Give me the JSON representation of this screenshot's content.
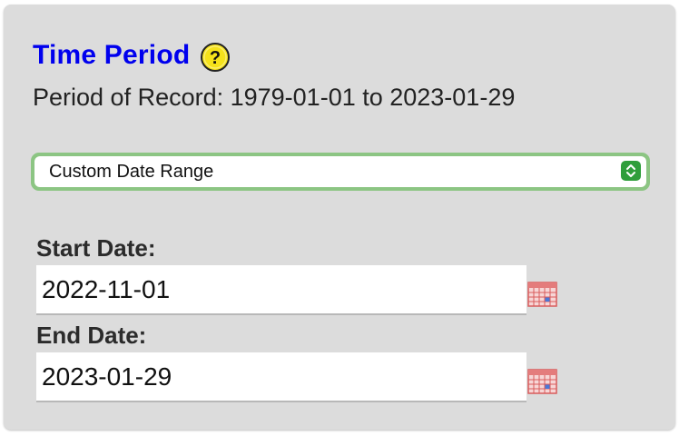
{
  "section": {
    "title": "Time Period",
    "help_icon": "question-help-icon",
    "period_of_record": "Period of Record: 1979-01-01 to 2023-01-29"
  },
  "period_select": {
    "selected": "Custom Date Range",
    "accent_color": "#8cc583"
  },
  "start_date": {
    "label": "Start Date:",
    "value": "2022-11-01",
    "icon": "calendar-icon"
  },
  "end_date": {
    "label": "End Date:",
    "value": "2023-01-29",
    "icon": "calendar-icon"
  },
  "colors": {
    "title": "#0000ee",
    "panel_bg": "#dcdcdc",
    "help_icon_fill": "#f5e21b",
    "stepper": "#2f9e3b",
    "calendar": "#e47c7c"
  }
}
